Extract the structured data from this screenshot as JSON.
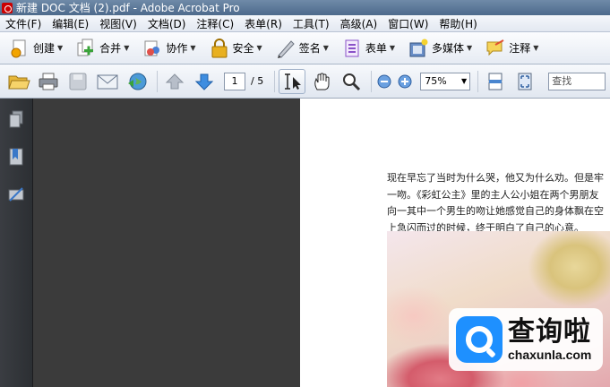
{
  "window": {
    "title": "新建 DOC 文档 (2).pdf - Adobe Acrobat Pro"
  },
  "menubar": {
    "items": [
      {
        "label": "文件(F)"
      },
      {
        "label": "编辑(E)"
      },
      {
        "label": "视图(V)"
      },
      {
        "label": "文档(D)"
      },
      {
        "label": "注释(C)"
      },
      {
        "label": "表单(R)"
      },
      {
        "label": "工具(T)"
      },
      {
        "label": "高级(A)"
      },
      {
        "label": "窗口(W)"
      },
      {
        "label": "帮助(H)"
      }
    ]
  },
  "tasks": {
    "create": "创建",
    "combine": "合并",
    "collaborate": "协作",
    "secure": "安全",
    "sign": "签名",
    "forms": "表单",
    "multimedia": "多媒体",
    "comment": "注释"
  },
  "toolbar": {
    "current_page": "1",
    "total_pages": "/ 5",
    "zoom": "75%",
    "find_placeholder": "查找"
  },
  "document": {
    "lines": [
      "现在早忘了当时为什么哭，他又为什么劝。但是牢",
      "一吻。《彩虹公主》里的主人公小姐在两个男朋友",
      "向一其中一个男生的吻让她感觉自己的身体飘在空",
      "上急闪而过的时候，终于明白了自己的心意。"
    ]
  },
  "watermark": {
    "brand": "查询啦",
    "domain": "chaxunla.com"
  },
  "colors": {
    "titlebar": "#5a7697",
    "docbg": "#3b3b3b",
    "navpane": "#34373b",
    "accent": "#1e90ff"
  }
}
